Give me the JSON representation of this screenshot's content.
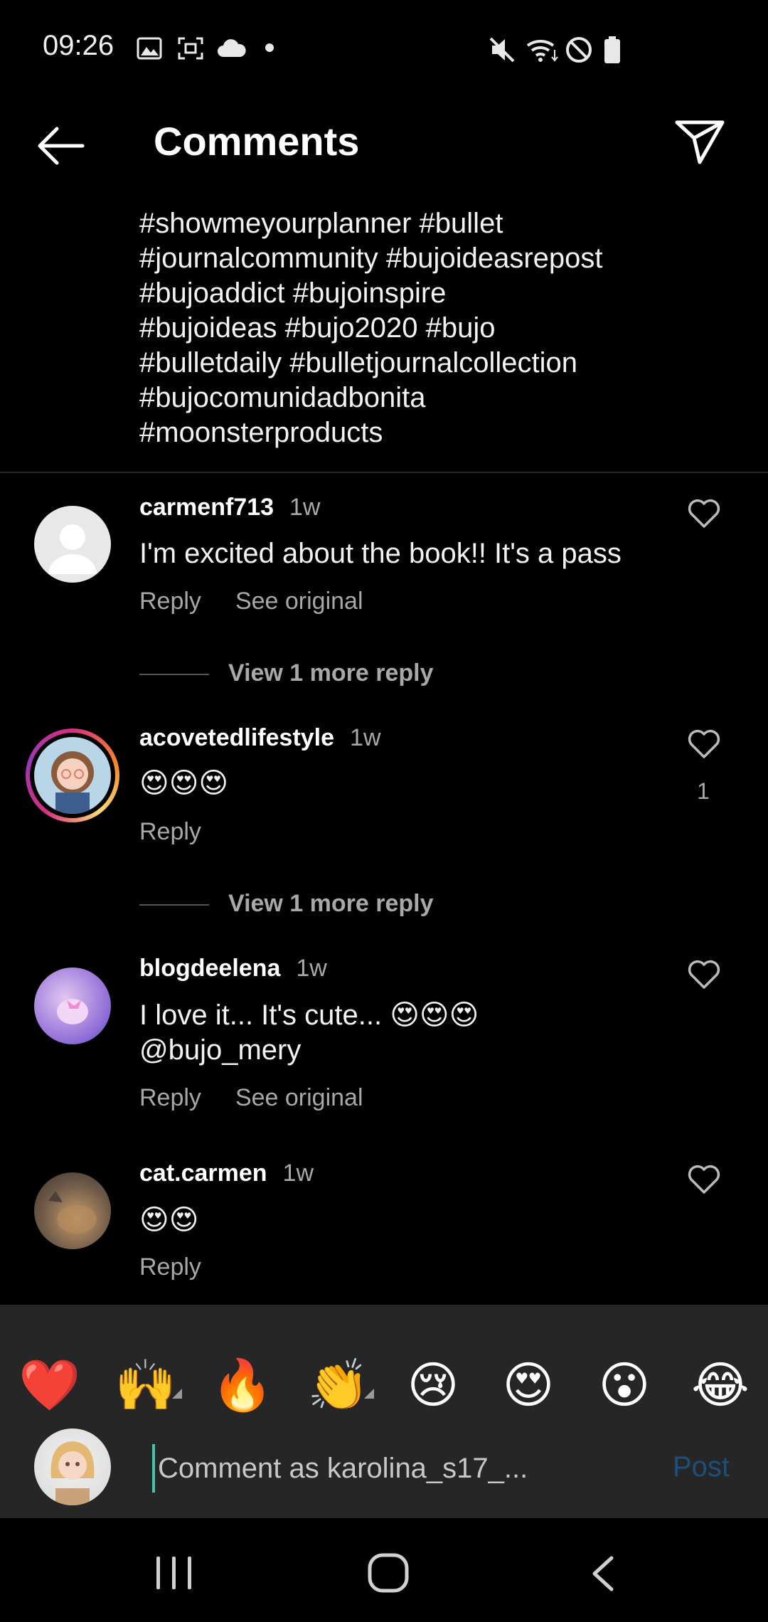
{
  "status_bar": {
    "time": "09:26",
    "left_icons": [
      "gallery-icon",
      "screenshot-icon",
      "cloud-icon",
      "dot-icon"
    ],
    "right_icons": [
      "mute-icon",
      "wifi-icon",
      "do-not-disturb-icon",
      "battery-icon"
    ]
  },
  "header": {
    "title": "Comments",
    "back_icon": "back-arrow-icon",
    "share_icon": "send-icon"
  },
  "caption": {
    "lines": [
      "#showmeyourplanner #bullet",
      "#journalcommunity #bujoideasrepost",
      "#bujoaddict #bujoinspire",
      "#bujoideas #bujo2020 #bujo",
      "#bulletdaily #bulletjournalcollection",
      "#bujocomunidadbonita",
      "#moonsterproducts"
    ]
  },
  "comments": [
    {
      "username": "carmenf713",
      "time": "1w",
      "text": "I'm excited about the book!! It's a pass",
      "actions": [
        "Reply",
        "See original"
      ],
      "view_more": "View 1 more reply"
    },
    {
      "username": "acovetedlifestyle",
      "time": "1w",
      "text": "😍😍😍",
      "actions": [
        "Reply"
      ],
      "likes": "1",
      "view_more": "View 1 more reply"
    },
    {
      "username": "blogdeelena",
      "time": "1w",
      "text_line1": "I love it... It's cute... 😍😍😍",
      "text_line2": "@bujo_mery",
      "actions": [
        "Reply",
        "See original"
      ]
    },
    {
      "username": "cat.carmen",
      "time": "1w",
      "text": "😍😍",
      "actions": [
        "Reply"
      ]
    }
  ],
  "emoji_bar": [
    "❤️",
    "🙌",
    "🔥",
    "👏",
    "😢",
    "😍",
    "😮",
    "😂"
  ],
  "composer": {
    "placeholder": "Comment as karolina_s17_...",
    "value": "",
    "post_label": "Post"
  },
  "nav_bar": {
    "icons": [
      "recent-apps-icon",
      "home-icon",
      "back-icon"
    ]
  },
  "colors": {
    "background": "#000000",
    "secondary_text": "#a8a8a8",
    "post_disabled": "#1d4f7a",
    "emoji_bar_bg": "#262626"
  }
}
